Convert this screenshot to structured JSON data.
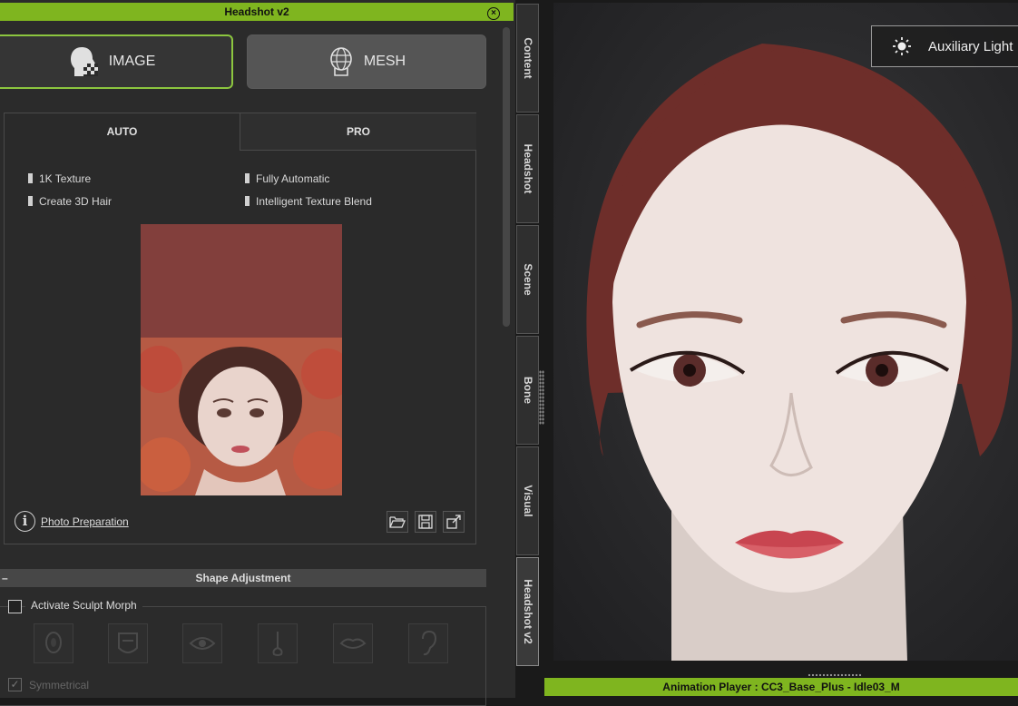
{
  "panel": {
    "title": "Headshot v2",
    "close_icon": "close-icon",
    "modes": [
      {
        "label": "IMAGE",
        "icon": "image-head-icon",
        "selected": true
      },
      {
        "label": "MESH",
        "icon": "mesh-head-icon",
        "selected": false
      }
    ],
    "tabs": [
      {
        "label": "AUTO",
        "selected": true
      },
      {
        "label": "PRO",
        "selected": false
      }
    ],
    "features": [
      "1K Texture",
      "Fully Automatic",
      "Create 3D Hair",
      "Intelligent Texture Blend"
    ],
    "photo_preparation": "Photo Preparation",
    "file_buttons": [
      "open-folder-icon",
      "save-icon",
      "export-icon"
    ]
  },
  "shape": {
    "title": "Shape Adjustment",
    "collapse": "–",
    "sculpt_label": "Activate Sculpt Morph",
    "symmetrical_label": "Symmetrical",
    "morph_icons": [
      "head-icon",
      "face-icon",
      "eye-icon",
      "nose-icon",
      "lips-icon",
      "ear-icon"
    ]
  },
  "side_tabs": [
    "Content",
    "Headshot",
    "Scene",
    "Bone",
    "Visual",
    "Headshot v2"
  ],
  "viewport": {
    "aux_light": "Auxiliary Light",
    "animation_player": "Animation Player : CC3_Base_Plus - Idle03_M"
  },
  "colors": {
    "accent": "#7fb51f",
    "image_border": "#8cc63f",
    "photo_top": "#823f3c"
  }
}
